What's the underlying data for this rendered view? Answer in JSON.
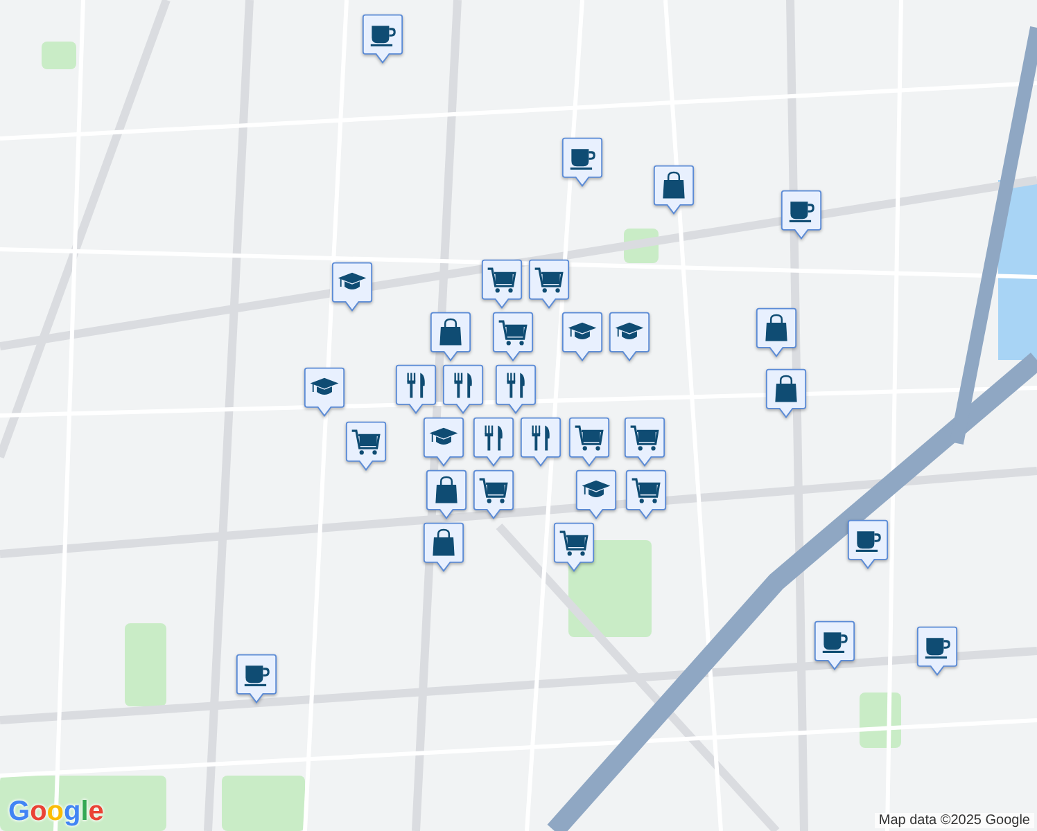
{
  "map": {
    "pins": [
      {
        "kind": "cafe"
      },
      {
        "kind": "cafe"
      },
      {
        "kind": "shop"
      },
      {
        "kind": "cafe"
      },
      {
        "kind": "school"
      },
      {
        "kind": "grocery"
      },
      {
        "kind": "grocery"
      },
      {
        "kind": "shop"
      },
      {
        "kind": "shop"
      },
      {
        "kind": "shop"
      },
      {
        "kind": "grocery"
      },
      {
        "kind": "school"
      },
      {
        "kind": "school"
      },
      {
        "kind": "restaurant"
      },
      {
        "kind": "restaurant"
      },
      {
        "kind": "school"
      },
      {
        "kind": "restaurant"
      },
      {
        "kind": "restaurant"
      },
      {
        "kind": "school"
      },
      {
        "kind": "restaurant"
      },
      {
        "kind": "grocery"
      },
      {
        "kind": "grocery"
      },
      {
        "kind": "grocery"
      },
      {
        "kind": "grocery"
      },
      {
        "kind": "school"
      },
      {
        "kind": "grocery"
      },
      {
        "kind": "shop"
      },
      {
        "kind": "shop"
      },
      {
        "kind": "grocery"
      },
      {
        "kind": "cafe"
      },
      {
        "kind": "cafe"
      },
      {
        "kind": "cafe"
      },
      {
        "kind": "cafe"
      }
    ]
  },
  "logo": "Google",
  "attribution": "Map data ©2025 Google"
}
